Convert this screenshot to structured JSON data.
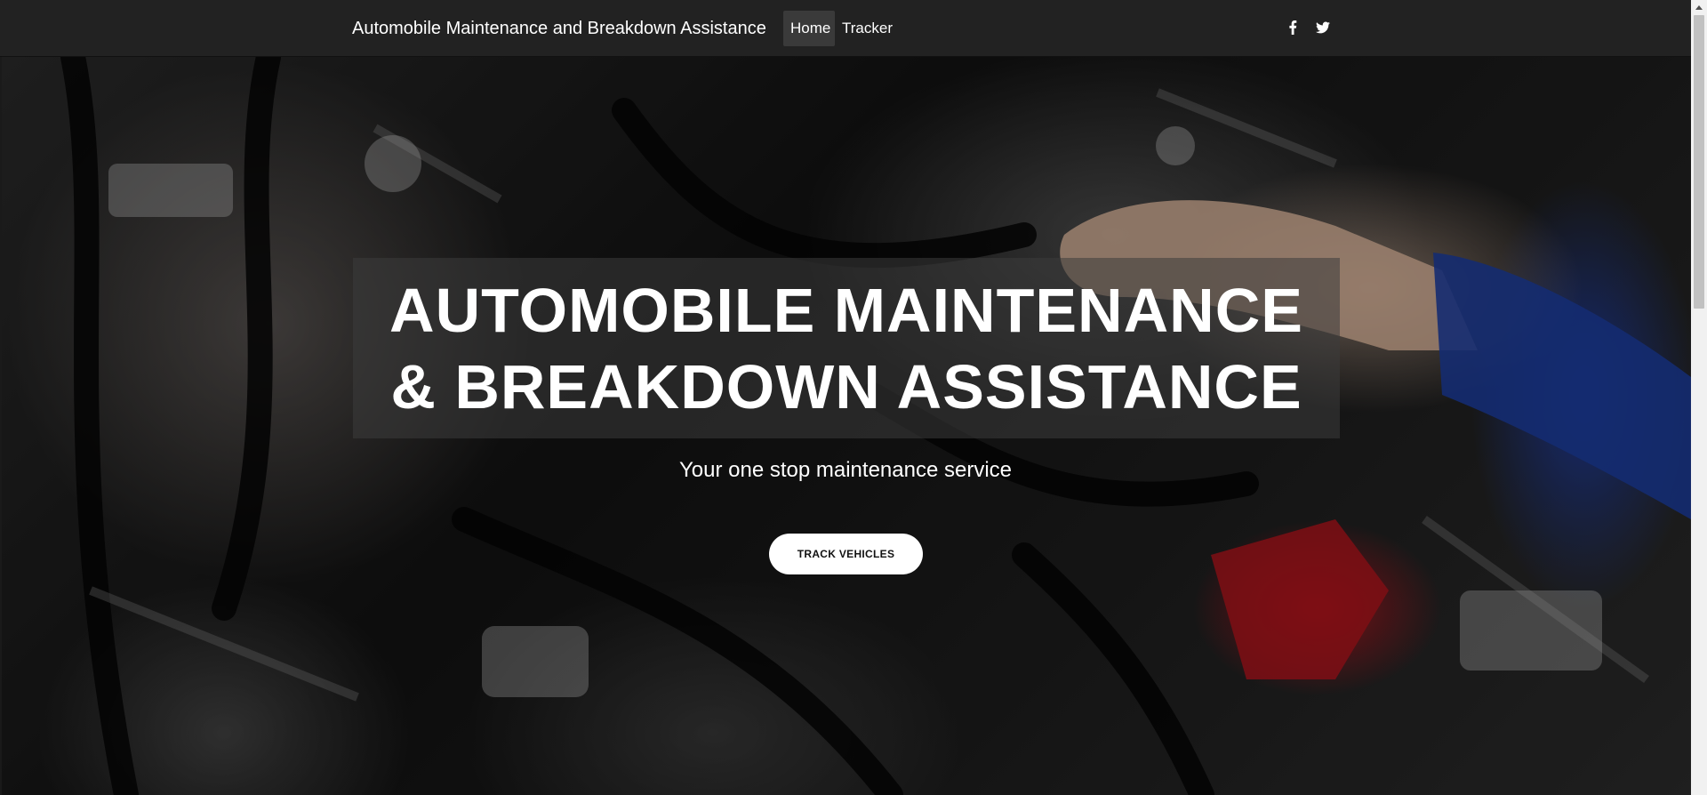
{
  "navbar": {
    "brand": "Automobile Maintenance and Breakdown Assistance",
    "items": [
      {
        "label": "Home",
        "active": true
      },
      {
        "label": "Tracker",
        "active": false
      }
    ],
    "social": [
      "facebook-icon",
      "twitter-icon"
    ]
  },
  "hero": {
    "title": "AUTOMOBILE MAINTENANCE & BREAKDOWN ASSISTANCE",
    "subtitle": "Your one stop maintenance service",
    "button_label": "TRACK VEHICLES"
  },
  "colors": {
    "navbar_bg": "#222222",
    "active_nav_bg": "#3a3a3a",
    "title_box_bg": "rgba(60,60,60,0.55)",
    "button_bg": "#ffffff",
    "text": "#ffffff"
  }
}
